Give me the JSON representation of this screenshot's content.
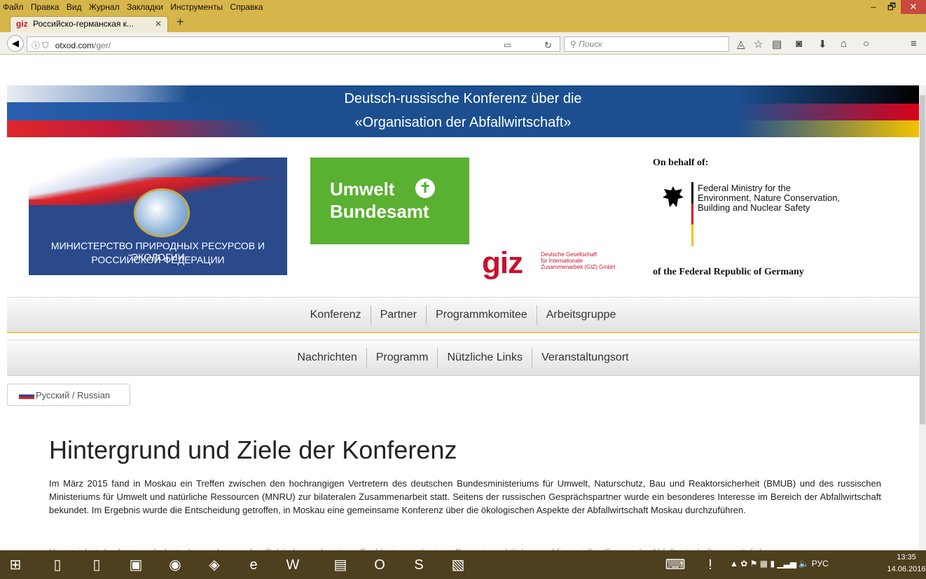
{
  "browser": {
    "menu": [
      "Файл",
      "Правка",
      "Вид",
      "Журнал",
      "Закладки",
      "Инструменты",
      "Справка"
    ],
    "window_buttons": {
      "minimize": "–",
      "maximize": "🗗",
      "close": "✕"
    },
    "tab": {
      "icon_text": "giz",
      "title": "Российско-германская к...",
      "close": "✕"
    },
    "new_tab": "+",
    "url": {
      "domain": "otxod.com",
      "path": "/ger/"
    },
    "search_placeholder": "Поиск"
  },
  "banner": {
    "line1": "Deutsch-russische Konferenz über die",
    "line2": "«Organisation der Abfallwirtschaft»"
  },
  "logos": {
    "mnr_line1": "МИНИСТЕРСТВО ПРИРОДНЫХ РЕСУРСОВ И ЭКОЛОГИИ",
    "mnr_line2": "РОССИЙСКОЙ ФЕДЕРАЦИИ",
    "uba_line1": "Umwelt",
    "uba_line2": "Bundesamt",
    "giz_mark": "giz",
    "giz_sub1": "Deutsche Gesellschaft",
    "giz_sub2": "für Internationale",
    "giz_sub3": "Zusammenarbeit (GIZ) GmbH",
    "on_behalf": "On behalf of:",
    "bmub_1": "Federal Ministry for the",
    "bmub_2": "Environment, Nature Conservation,",
    "bmub_3": "Building and Nuclear Safety",
    "frg": "of the Federal Republic of Germany"
  },
  "nav1": [
    "Konferenz",
    "Partner",
    "Programmkomitee",
    "Arbeitsgruppe"
  ],
  "nav2": [
    "Nachrichten",
    "Programm",
    "Nützliche Links",
    "Veranstaltungsort"
  ],
  "lang_button": "Русский / Russian",
  "content": {
    "heading": "Hintergrund und Ziele der Konferenz",
    "paragraph": "Im März 2015 fand in Moskau ein Treffen zwischen den hochrangigen Vertretern des deutschen Bundesministeriums für Umwelt, Naturschutz, Bau und Reaktorsicherheit (BMUB) und des russischen Ministeriums für Umwelt und natürliche Ressourcen (MNRU) zur bilateralen Zusammenarbeit statt. Seitens der russischen Gesprächspartner wurde ein besonderes Interesse im Bereich der Abfallwirtschaft bekundet. Im Ergebnis wurde die Entscheidung getroffen, in Moskau eine gemeinsame Konferenz über die ökologischen Aspekte der Abfallwirtschaft Moskau durchzuführen.",
    "paragraph2": "Hauptziel ist der Austausch deutscher und russischer Behörden und weiterer Fachleute zu gängigen Praxis in rechtlichen und finanziellen Fragen der Abfallwirtschaft, um mögliche"
  },
  "taskbar": {
    "lang": "РУС",
    "time": "13:35",
    "date": "14.06.2016"
  }
}
